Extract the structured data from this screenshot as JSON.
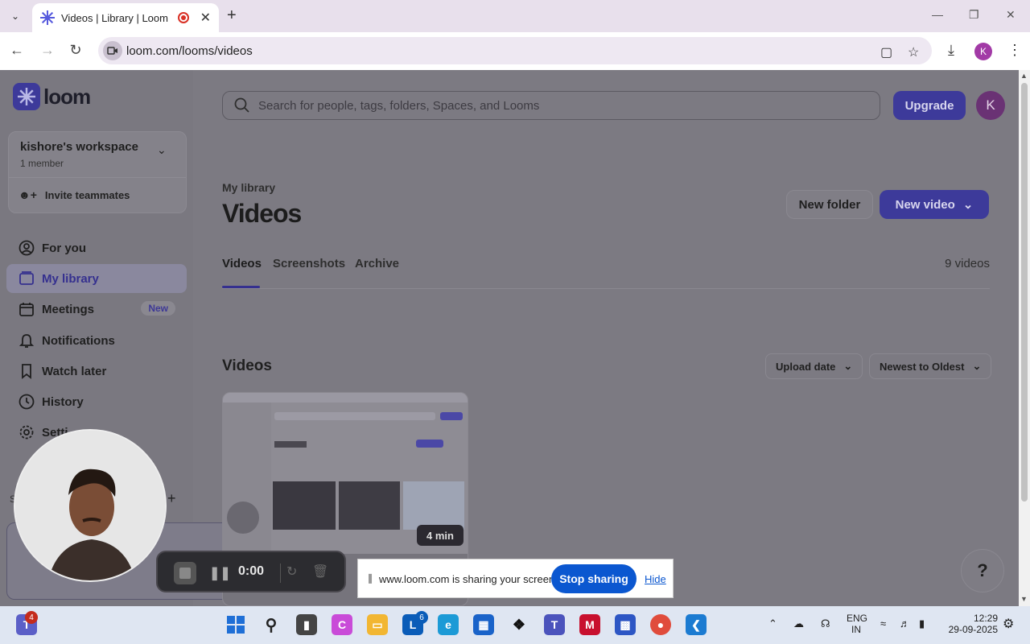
{
  "browser": {
    "tab_title": "Videos | Library | Loom",
    "url": "loom.com/looms/videos",
    "profile_initial": "K"
  },
  "sidebar": {
    "logo_text": "loom",
    "workspace_name": "kishore's workspace",
    "workspace_members": "1 member",
    "invite_label": "Invite teammates",
    "nav": [
      {
        "label": "For you",
        "icon": "user-icon"
      },
      {
        "label": "My library",
        "icon": "library-icon"
      },
      {
        "label": "Meetings",
        "icon": "calendar-icon",
        "badge": "New"
      },
      {
        "label": "Notifications",
        "icon": "bell-icon"
      },
      {
        "label": "Watch later",
        "icon": "bookmark-icon"
      },
      {
        "label": "History",
        "icon": "clock-icon"
      },
      {
        "label": "Setti",
        "icon": "gear-icon"
      }
    ]
  },
  "header": {
    "search_placeholder": "Search for people, tags, folders, Spaces, and Looms",
    "upgrade_label": "Upgrade",
    "avatar_initial": "K"
  },
  "main": {
    "breadcrumb": "My library",
    "title": "Videos",
    "new_folder_label": "New folder",
    "new_video_label": "New video",
    "tabs": [
      "Videos",
      "Screenshots",
      "Archive"
    ],
    "video_count": "9 videos",
    "section_title": "Videos",
    "sort_field": "Upload date",
    "sort_order": "Newest to Oldest",
    "card_duration": "4 min"
  },
  "recorder": {
    "time": "0:00"
  },
  "share_notice": {
    "text": "www.loom.com is sharing your screen.",
    "stop_label": "Stop sharing",
    "hide_label": "Hide"
  },
  "taskbar": {
    "lang_line1": "ENG",
    "lang_line2": "IN",
    "time": "12:29",
    "date": "29-09-2025",
    "badge_teams": "4",
    "badge_l": "6"
  },
  "colors": {
    "brand": "#565add",
    "share_blue": "#0b57d0"
  }
}
